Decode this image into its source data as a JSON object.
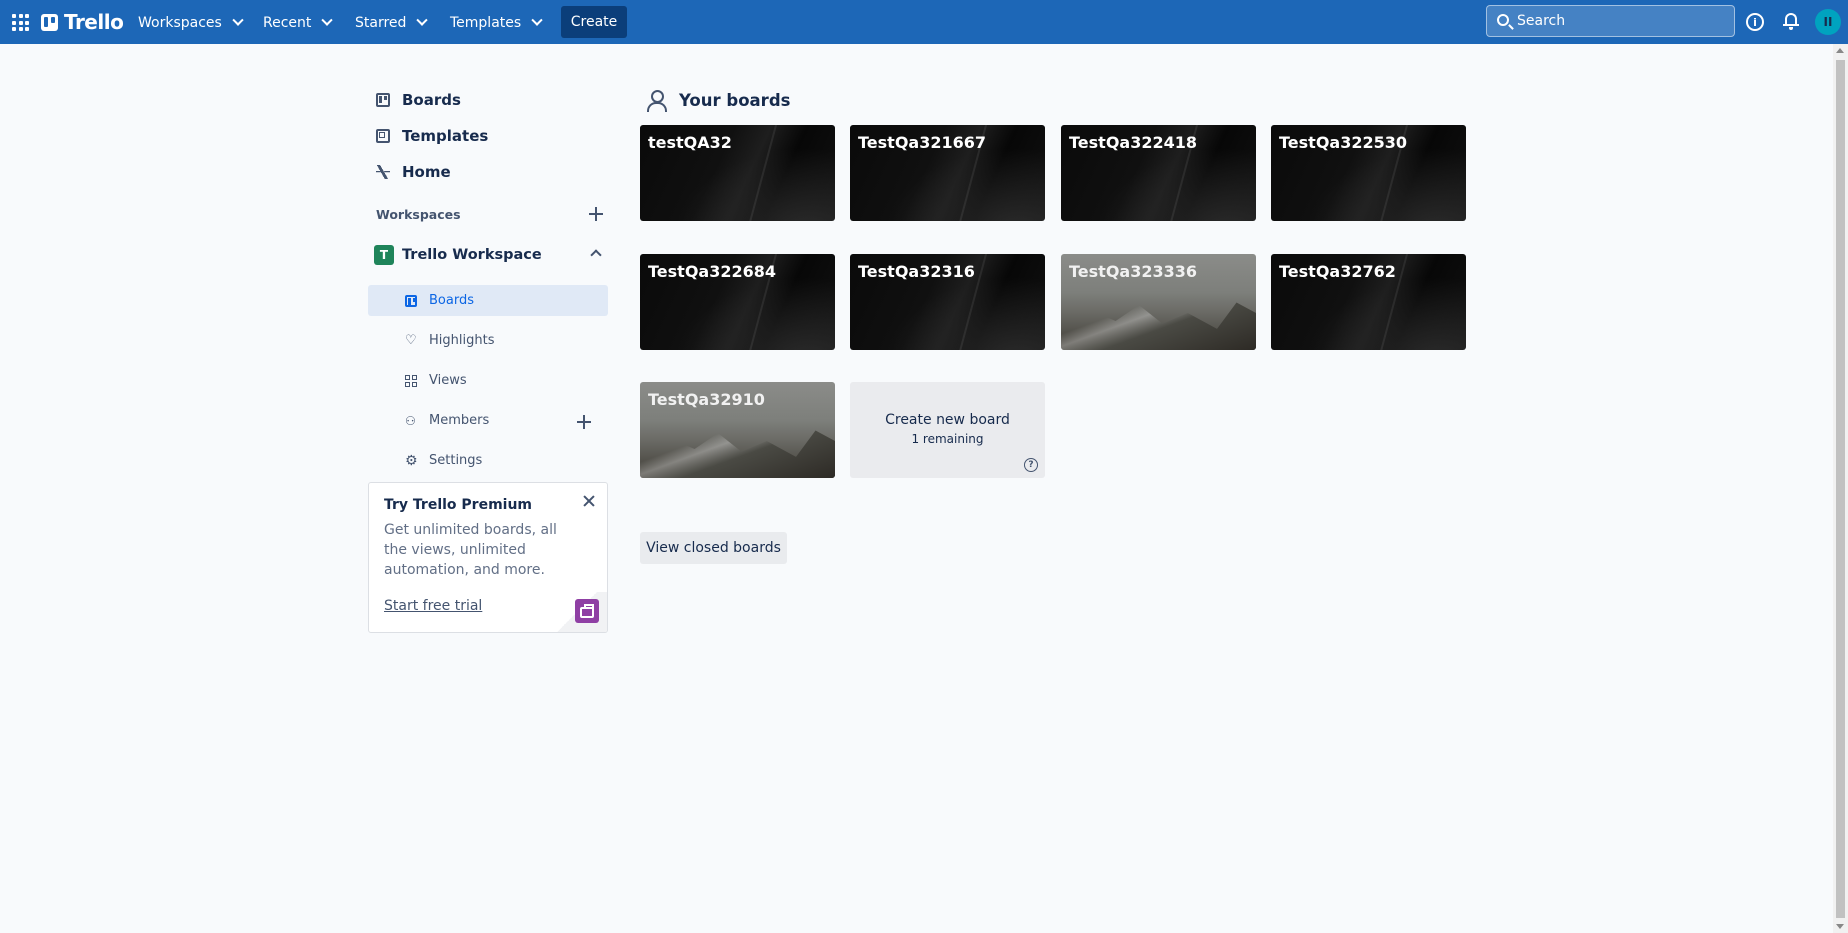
{
  "header": {
    "logo_text": "Trello",
    "nav": [
      "Workspaces",
      "Recent",
      "Starred",
      "Templates"
    ],
    "create_label": "Create",
    "search_placeholder": "Search",
    "avatar_initials": "II",
    "colors": {
      "header_bg": "#1d67b7",
      "create_bg": "#0b3e7a",
      "avatar_bg": "#00a3bf"
    }
  },
  "sidebar": {
    "top_items": [
      {
        "label": "Boards",
        "icon": "board-icon"
      },
      {
        "label": "Templates",
        "icon": "template-icon"
      },
      {
        "label": "Home",
        "icon": "pulse-icon"
      }
    ],
    "workspaces_heading": "Workspaces",
    "workspace": {
      "badge": "T",
      "name": "Trello Workspace",
      "items": [
        {
          "label": "Boards",
          "icon": "board-icon",
          "active": true
        },
        {
          "label": "Highlights",
          "icon": "heart-icon"
        },
        {
          "label": "Views",
          "icon": "grid-icon"
        },
        {
          "label": "Members",
          "icon": "members-icon"
        },
        {
          "label": "Settings",
          "icon": "gear-icon"
        }
      ]
    },
    "premium": {
      "title": "Try Trello Premium",
      "body": "Get unlimited boards, all the views, unlimited automation, and more.",
      "link": "Start free trial"
    }
  },
  "main": {
    "title": "Your boards",
    "boards": [
      {
        "name": "testQA32",
        "background": "dark"
      },
      {
        "name": "TestQa321667",
        "background": "dark"
      },
      {
        "name": "TestQa322418",
        "background": "dark"
      },
      {
        "name": "TestQa322530",
        "background": "dark"
      },
      {
        "name": "TestQa322684",
        "background": "dark"
      },
      {
        "name": "TestQa32316",
        "background": "dark"
      },
      {
        "name": "TestQa323336",
        "background": "mountain"
      },
      {
        "name": "TestQa32762",
        "background": "dark"
      },
      {
        "name": "TestQa32910",
        "background": "mountain"
      }
    ],
    "create_board": {
      "label": "Create new board",
      "remaining": "1 remaining"
    },
    "view_closed_label": "View closed boards"
  }
}
